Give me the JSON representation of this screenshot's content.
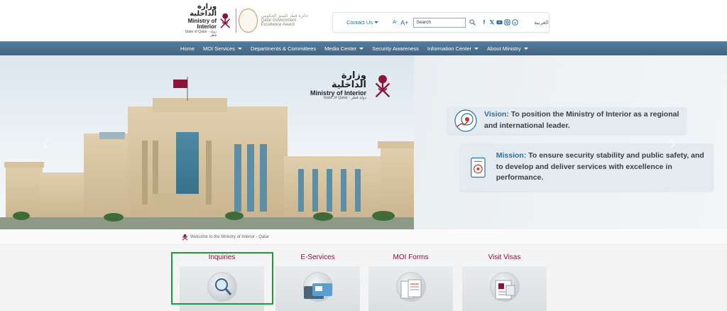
{
  "header": {
    "logo": {
      "arabic_name": "وزارة الداخلية",
      "english_name": "Ministry of Interior",
      "subtitle": "State of Qatar - دولة قطر"
    },
    "award": {
      "arabic_name": "جائزة قطر للتميز الحكومي",
      "english_name": "Qatar Government Excellence Award"
    },
    "toolbar": {
      "contact_label": "Contact Us",
      "font_decrease": "A-",
      "font_increase": "A+",
      "search_placeholder": "Search",
      "social_icons": [
        "facebook-icon",
        "x-icon",
        "youtube-icon",
        "instagram-icon",
        "snapchat-icon"
      ],
      "language_label": "العربية"
    }
  },
  "nav": {
    "items": [
      {
        "label": "Home",
        "has_dropdown": false
      },
      {
        "label": "MOI Services",
        "has_dropdown": true
      },
      {
        "label": "Departments & Committees",
        "has_dropdown": false
      },
      {
        "label": "Media Center",
        "has_dropdown": true
      },
      {
        "label": "Security Awareness",
        "has_dropdown": false
      },
      {
        "label": "Information Center",
        "has_dropdown": true
      },
      {
        "label": "About Ministry",
        "has_dropdown": true
      }
    ]
  },
  "hero": {
    "logo": {
      "arabic_name": "وزارة الداخلية",
      "english_name": "Ministry of Interior",
      "subtitle": "State of Qatar - دولة قطر"
    },
    "vision": {
      "key": "Vision:",
      "line1": " To position the Ministry of Interior as a regional",
      "line2": "and international leader."
    },
    "mission": {
      "key": "Mission:",
      "line1": " To ensure security stability and public safety, and",
      "line2": "to develop and deliver services with excellence in performance."
    }
  },
  "welcome": {
    "text": "Welcome to the Ministry of Interior - Qatar"
  },
  "tiles": [
    {
      "title": "Inquiries",
      "icon": "magnifier-icon",
      "highlighted": true
    },
    {
      "title": "E-Services",
      "icon": "cards-icon",
      "highlighted": false
    },
    {
      "title": "MOI Forms",
      "icon": "forms-icon",
      "highlighted": false
    },
    {
      "title": "Visit Visas",
      "icon": "visa-icon",
      "highlighted": false
    }
  ],
  "colors": {
    "brand_maroon": "#8a1538",
    "nav_blue": "#4a6f8f",
    "link_blue": "#2b6a9a",
    "highlight_green": "#1f9a3a"
  }
}
